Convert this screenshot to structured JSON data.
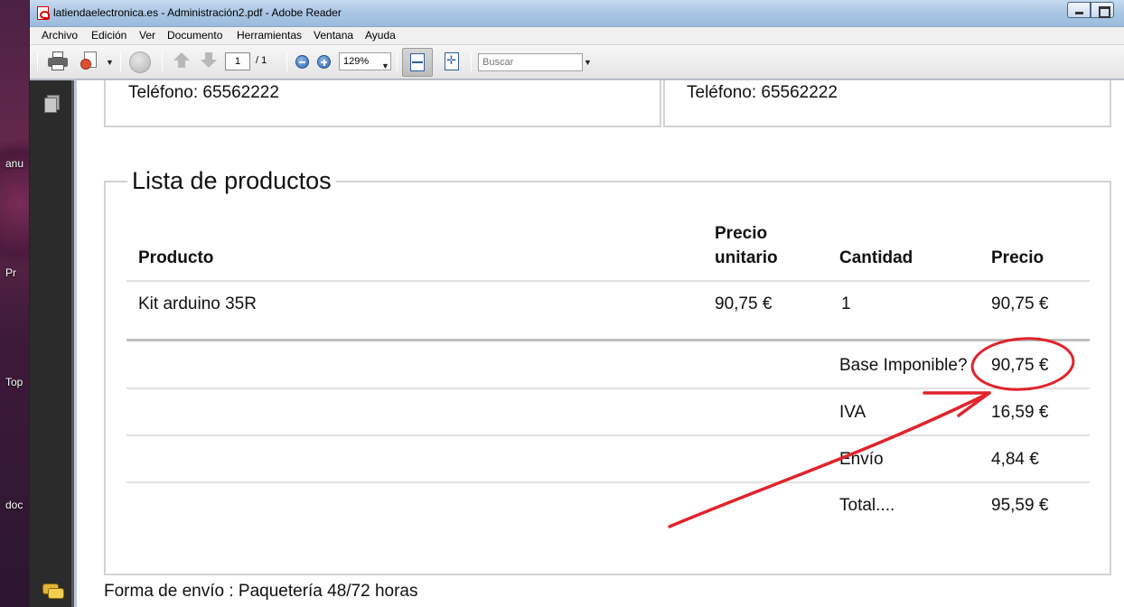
{
  "window": {
    "title": "latiendaelectronica.es - Administración2.pdf - Adobe Reader"
  },
  "desktop": {
    "labels": [
      "anu",
      "Pr",
      "Top",
      "doc"
    ]
  },
  "menu": [
    "Archivo",
    "Edición",
    "Ver",
    "Documento",
    "Herramientas",
    "Ventana",
    "Ayuda"
  ],
  "toolbar": {
    "page_current": "1",
    "page_total": "/ 1",
    "zoom": "129%",
    "search_placeholder": "Buscar"
  },
  "document": {
    "contact_left": "Teléfono: 65562222",
    "contact_right": "Teléfono: 65562222",
    "section_title": "Lista de productos",
    "table": {
      "headers": {
        "product": "Producto",
        "unit_price_line1": "Precio",
        "unit_price_line2": "unitario",
        "quantity": "Cantidad",
        "price": "Precio"
      },
      "rows": [
        {
          "product": "Kit arduino 35R",
          "unit_price": "90,75 €",
          "quantity": "1",
          "price": "90,75 €"
        }
      ],
      "summary": [
        {
          "label": "Base Imponible?",
          "value": "90,75 €"
        },
        {
          "label": "IVA",
          "value": "16,59 €"
        },
        {
          "label": "Envío",
          "value": "4,84 €"
        },
        {
          "label": "Total....",
          "value": "95,59 €"
        }
      ]
    },
    "shipping": "Forma de envío : Paquetería 48/72 horas"
  },
  "colors": {
    "annotation": "#e0242c",
    "titlebar": "#aac5e3",
    "navpanel": "#2b2b2b"
  }
}
